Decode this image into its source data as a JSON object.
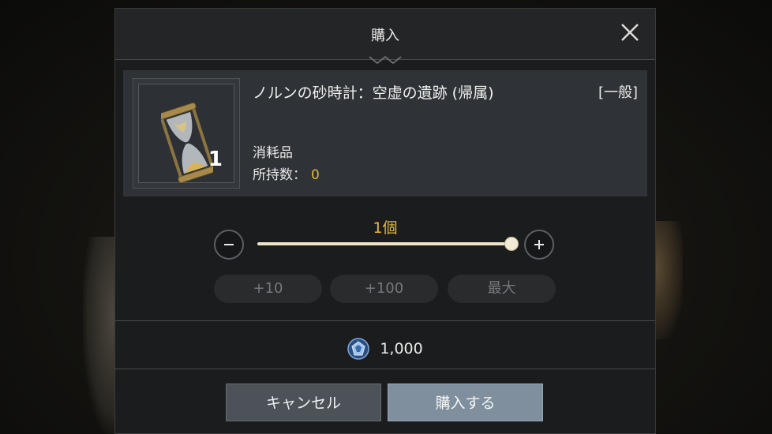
{
  "dialog": {
    "title": "購入",
    "close_icon": "close-icon"
  },
  "item": {
    "icon": "hourglass-icon",
    "name": "ノルンの砂時計：空虚の遺跡 (帰属)",
    "grade": "[一般]",
    "quantity": "1",
    "type": "消耗品",
    "owned_label": "所持数：",
    "owned_value": "0"
  },
  "quantity_selector": {
    "count_label": "1個",
    "minus_icon": "minus-icon",
    "plus_icon": "plus-icon",
    "slider_fraction": 1.0,
    "plus10_label": "+10",
    "plus100_label": "+100",
    "max_label": "最大"
  },
  "price": {
    "currency_icon": "crystal-currency-icon",
    "value": "1,000"
  },
  "footer": {
    "cancel_label": "キャンセル",
    "buy_label": "購入する"
  },
  "colors": {
    "accent_gold": "#e3ba3f",
    "dialog_bg": "#1b1c1d",
    "card_bg": "#2f3236",
    "buy_button": "#7f8f9d",
    "cancel_button": "#4c5257"
  }
}
